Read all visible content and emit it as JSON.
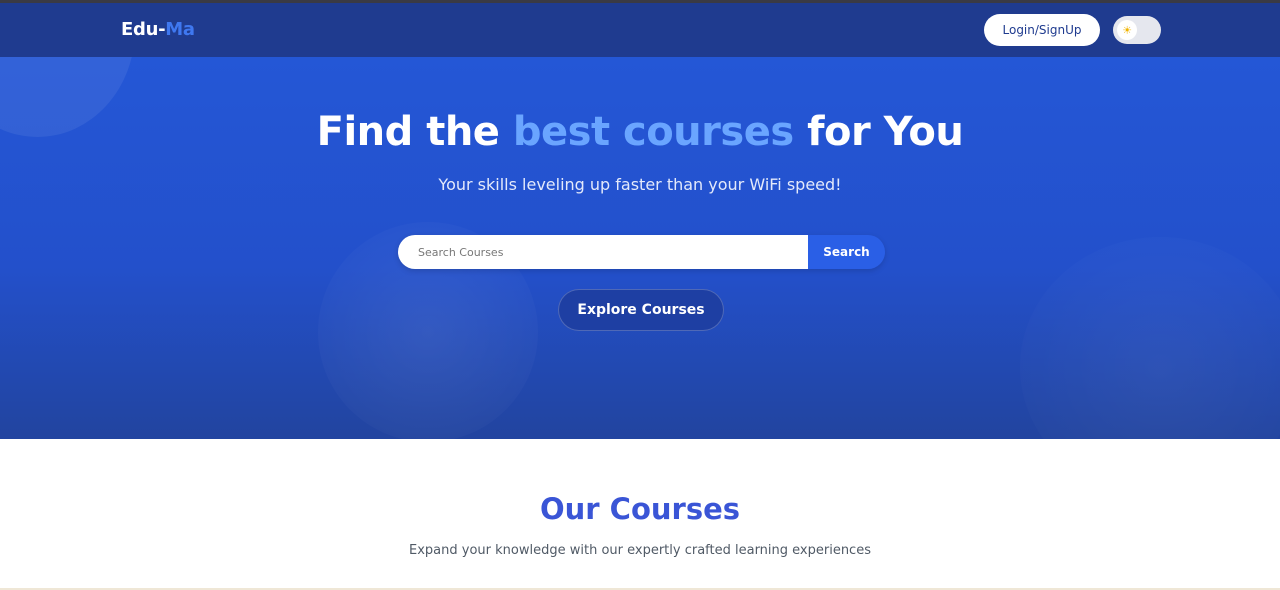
{
  "navbar": {
    "brand_part1": "Edu-",
    "brand_part2": "Ma",
    "login_label": "Login/SignUp",
    "theme_toggle_icon": "sun-icon",
    "theme_toggle_state": "light"
  },
  "hero": {
    "title_before": "Find the ",
    "title_highlight": "best courses",
    "title_after": " for You",
    "subtitle": "Your skills leveling up faster than your WiFi speed!",
    "search_placeholder": "Search Courses",
    "search_value": "",
    "search_button": "Search",
    "explore_button": "Explore Courses"
  },
  "courses": {
    "title": "Our Courses",
    "subtitle": "Expand your knowledge with our expertly crafted learning experiences"
  },
  "colors": {
    "navbar_bg": "#1f3b8f",
    "hero_bg": "#2457d6",
    "accent": "#3f78f0",
    "highlight": "#6aa5ff",
    "section_title": "#3a55d6"
  }
}
